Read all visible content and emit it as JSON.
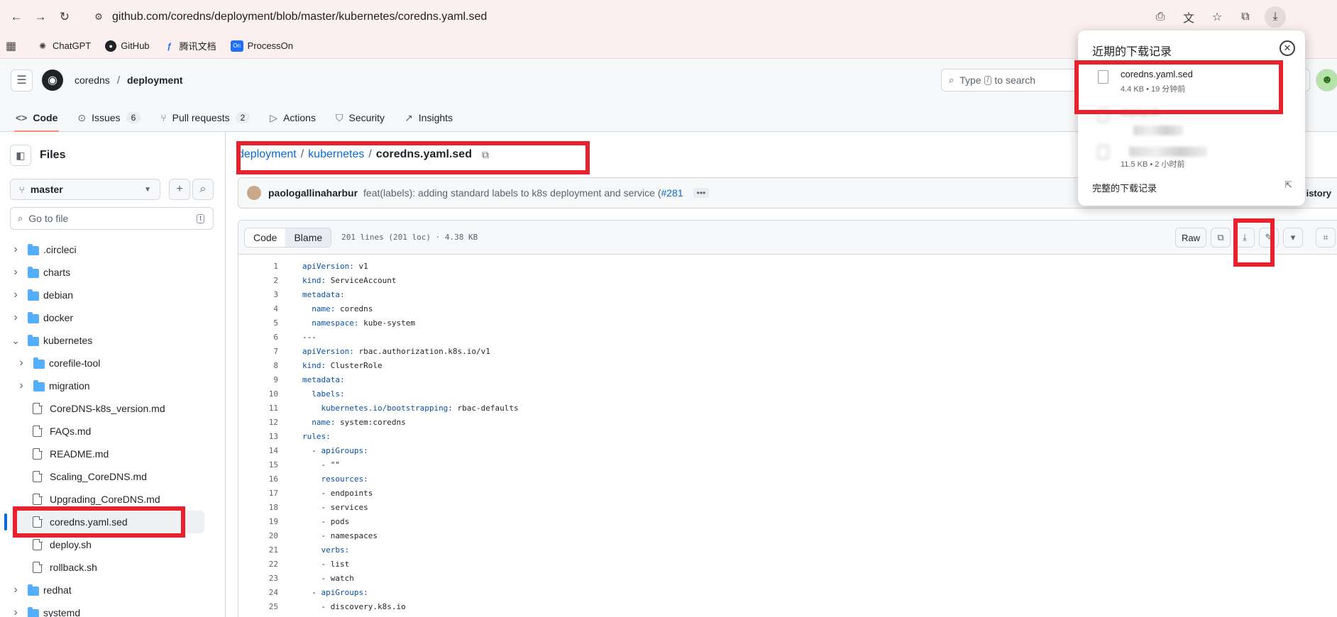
{
  "browser": {
    "url": "github.com/coredns/deployment/blob/master/kubernetes/coredns.yaml.sed",
    "bookmarks": [
      {
        "label": "ChatGPT",
        "icon": "chatgpt-icon"
      },
      {
        "label": "GitHub",
        "icon": "github-icon"
      },
      {
        "label": "腾讯文档",
        "icon": "tencent-docs-icon"
      },
      {
        "label": "ProcessOn",
        "icon": "processon-icon",
        "badge": "On"
      }
    ]
  },
  "header": {
    "owner": "coredns",
    "repo": "deployment",
    "search_prefix": "Type",
    "search_key": "/",
    "search_suffix": "to search"
  },
  "tabs": [
    {
      "label": "Code",
      "icon": "code-icon",
      "active": true
    },
    {
      "label": "Issues",
      "icon": "issue-icon",
      "count": "6"
    },
    {
      "label": "Pull requests",
      "icon": "pull-request-icon",
      "count": "2"
    },
    {
      "label": "Actions",
      "icon": "play-icon"
    },
    {
      "label": "Security",
      "icon": "shield-icon"
    },
    {
      "label": "Insights",
      "icon": "graph-icon"
    }
  ],
  "sidebar": {
    "title": "Files",
    "branch": "master",
    "goto_placeholder": "Go to file",
    "goto_key": "t",
    "tree": [
      {
        "label": ".circleci",
        "type": "folder",
        "depth": 0,
        "expanded": false
      },
      {
        "label": "charts",
        "type": "folder",
        "depth": 0,
        "expanded": false
      },
      {
        "label": "debian",
        "type": "folder",
        "depth": 0,
        "expanded": false
      },
      {
        "label": "docker",
        "type": "folder",
        "depth": 0,
        "expanded": false
      },
      {
        "label": "kubernetes",
        "type": "folder",
        "depth": 0,
        "expanded": true
      },
      {
        "label": "corefile-tool",
        "type": "folder",
        "depth": 1,
        "expanded": false
      },
      {
        "label": "migration",
        "type": "folder",
        "depth": 1,
        "expanded": false
      },
      {
        "label": "CoreDNS-k8s_version.md",
        "type": "file",
        "depth": 1
      },
      {
        "label": "FAQs.md",
        "type": "file",
        "depth": 1
      },
      {
        "label": "README.md",
        "type": "file",
        "depth": 1
      },
      {
        "label": "Scaling_CoreDNS.md",
        "type": "file",
        "depth": 1
      },
      {
        "label": "Upgrading_CoreDNS.md",
        "type": "file",
        "depth": 1
      },
      {
        "label": "coredns.yaml.sed",
        "type": "file",
        "depth": 1,
        "selected": true
      },
      {
        "label": "deploy.sh",
        "type": "file",
        "depth": 1
      },
      {
        "label": "rollback.sh",
        "type": "file",
        "depth": 1
      },
      {
        "label": "redhat",
        "type": "folder",
        "depth": 0,
        "expanded": false
      },
      {
        "label": "systemd",
        "type": "folder",
        "depth": 0,
        "expanded": false
      }
    ]
  },
  "main": {
    "path": {
      "dir1": "deployment",
      "dir2": "kubernetes",
      "file": "coredns.yaml.sed"
    },
    "commit": {
      "author": "paologallinaharbur",
      "message": "feat(labels): adding standard labels to k8s deployment and service (",
      "link": "#281",
      "history": "istory"
    },
    "code_header": {
      "tab_code": "Code",
      "tab_blame": "Blame",
      "meta": "201 lines (201 loc) · 4.38 KB",
      "raw": "Raw"
    },
    "lines": [
      {
        "n": "1",
        "key": "apiVersion:",
        "val": " v1",
        "indent": ""
      },
      {
        "n": "2",
        "key": "kind:",
        "val": " ServiceAccount",
        "indent": ""
      },
      {
        "n": "3",
        "key": "metadata:",
        "val": "",
        "indent": ""
      },
      {
        "n": "4",
        "key": "name:",
        "val": " coredns",
        "indent": "  "
      },
      {
        "n": "5",
        "key": "namespace:",
        "val": " kube-system",
        "indent": "  "
      },
      {
        "n": "6",
        "key": "",
        "val": "---",
        "indent": ""
      },
      {
        "n": "7",
        "key": "apiVersion:",
        "val": " rbac.authorization.k8s.io/v1",
        "indent": ""
      },
      {
        "n": "8",
        "key": "kind:",
        "val": " ClusterRole",
        "indent": ""
      },
      {
        "n": "9",
        "key": "metadata:",
        "val": "",
        "indent": ""
      },
      {
        "n": "10",
        "key": "labels:",
        "val": "",
        "indent": "  "
      },
      {
        "n": "11",
        "key": "kubernetes.io/bootstrapping:",
        "val": " rbac-defaults",
        "indent": "    "
      },
      {
        "n": "12",
        "key": "name:",
        "val": " system:coredns",
        "indent": "  "
      },
      {
        "n": "13",
        "key": "rules:",
        "val": "",
        "indent": ""
      },
      {
        "n": "14",
        "key": "apiGroups:",
        "val": "",
        "indent": "  - "
      },
      {
        "n": "15",
        "key": "",
        "val": "- \"\"",
        "indent": "    "
      },
      {
        "n": "16",
        "key": "resources:",
        "val": "",
        "indent": "    "
      },
      {
        "n": "17",
        "key": "",
        "val": "- endpoints",
        "indent": "    "
      },
      {
        "n": "18",
        "key": "",
        "val": "- services",
        "indent": "    "
      },
      {
        "n": "19",
        "key": "",
        "val": "- pods",
        "indent": "    "
      },
      {
        "n": "20",
        "key": "",
        "val": "- namespaces",
        "indent": "    "
      },
      {
        "n": "21",
        "key": "verbs:",
        "val": "",
        "indent": "    "
      },
      {
        "n": "22",
        "key": "",
        "val": "- list",
        "indent": "    "
      },
      {
        "n": "23",
        "key": "",
        "val": "- watch",
        "indent": "    "
      },
      {
        "n": "24",
        "key": "apiGroups:",
        "val": "",
        "indent": "  - "
      },
      {
        "n": "25",
        "key": "",
        "val": "- discovery.k8s.io",
        "indent": "    "
      }
    ]
  },
  "downloads": {
    "title": "近期的下载记录",
    "items": [
      {
        "name": "coredns.yaml.sed",
        "info": "4.4 KB • 19 分钟前"
      },
      {
        "name": "deploy.sh",
        "info": ""
      },
      {
        "name": "",
        "info": "11.5 KB • 2 小时前"
      }
    ],
    "all_label": "完整的下载记录"
  },
  "colors": {
    "accent": "#0969da",
    "highlight": "#e8212d",
    "tab_underline": "#fd8c73"
  }
}
